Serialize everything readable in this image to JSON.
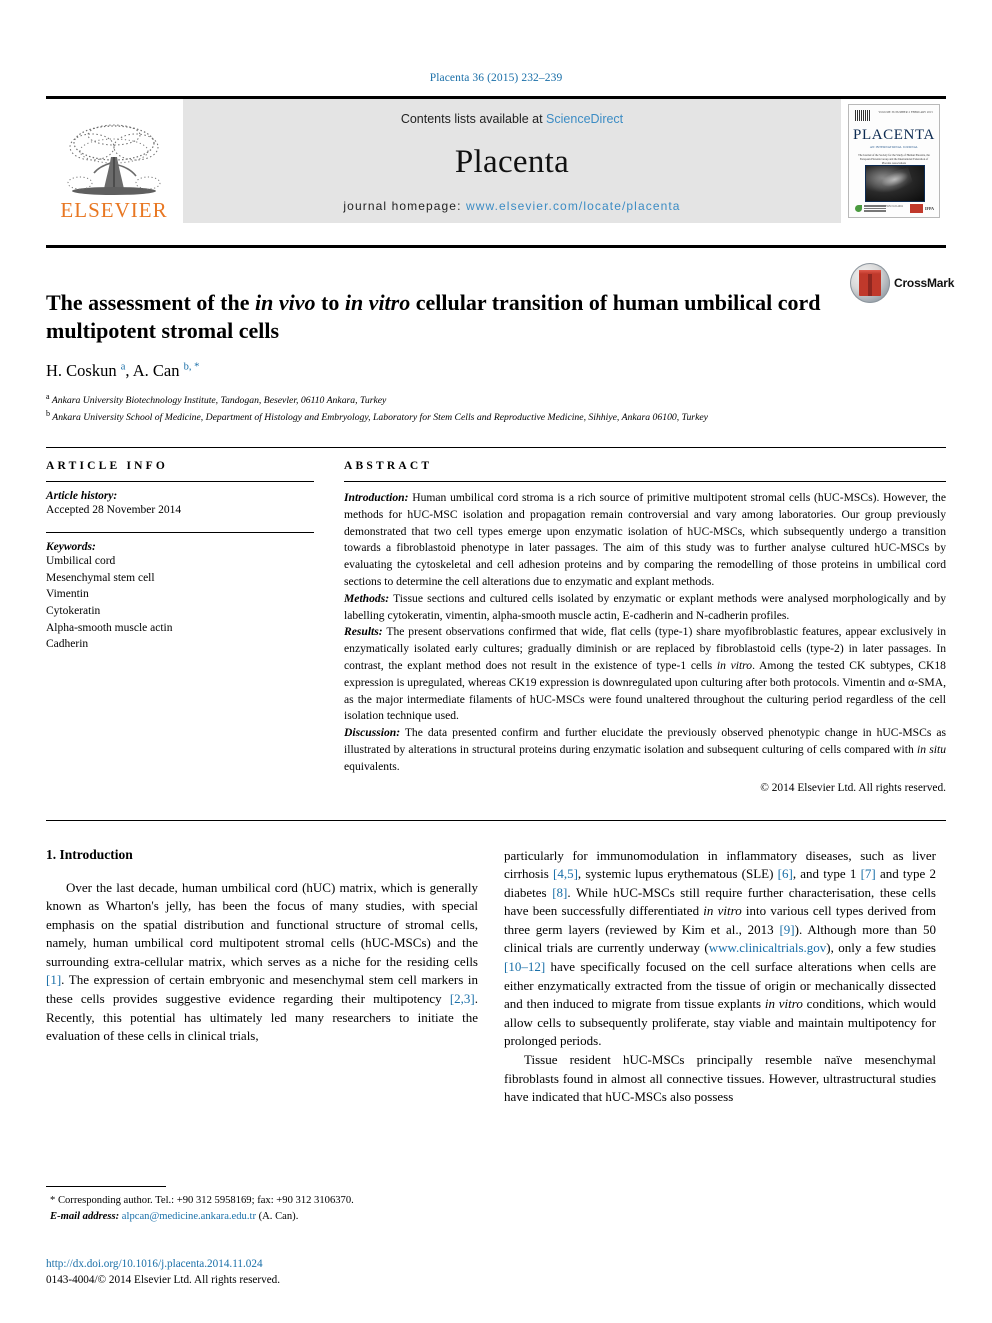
{
  "running_head": "Placenta 36 (2015) 232–239",
  "masthead": {
    "publisher": "ELSEVIER",
    "contents_prefix": "Contents lists available at ",
    "contents_link": "ScienceDirect",
    "journal_name": "Placenta",
    "homepage_prefix": "journal homepage: ",
    "homepage_url": "www.elsevier.com/locate/placenta",
    "cover": {
      "title": "PLACENTA",
      "subtitle": "AN INTERNATIONAL JOURNAL",
      "tagline": "The Journal of the Society for the Study of Human Placenta, the European Placenta Group and the International Federation of Placenta Associations",
      "topright": "VOLUME 36 NUMBER 2 FEBRUARY 2015",
      "caption": "ISSN 0143-4004",
      "badge": "IFPA"
    }
  },
  "article": {
    "title_part1": "The assessment of the ",
    "title_italic1": "in vivo",
    "title_part2": " to ",
    "title_italic2": "in vitro",
    "title_part3": " cellular transition of human umbilical cord multipotent stromal cells",
    "authors_plain": "H. Coskun ",
    "author1_sup": "a",
    "authors_mid": ", A. Can ",
    "author2_sup": "b, *",
    "affiliation_a_sup": "a",
    "affiliation_a": " Ankara University Biotechnology Institute, Tandogan, Besevler, 06110 Ankara, Turkey",
    "affiliation_b_sup": "b",
    "affiliation_b": " Ankara University School of Medicine, Department of Histology and Embryology, Laboratory for Stem Cells and Reproductive Medicine, Sihhiye, Ankara 06100, Turkey",
    "crossmark_label": "CrossMark"
  },
  "article_info": {
    "heading": "ARTICLE INFO",
    "history_label": "Article history:",
    "history_value": "Accepted 28 November 2014",
    "keywords_label": "Keywords:",
    "keywords": [
      "Umbilical cord",
      "Mesenchymal stem cell",
      "Vimentin",
      "Cytokeratin",
      "Alpha-smooth muscle actin",
      "Cadherin"
    ]
  },
  "abstract": {
    "heading": "ABSTRACT",
    "intro_label": "Introduction:",
    "intro_text": " Human umbilical cord stroma is a rich source of primitive multipotent stromal cells (hUC-MSCs). However, the methods for hUC-MSC isolation and propagation remain controversial and vary among laboratories. Our group previously demonstrated that two cell types emerge upon enzymatic isolation of hUC-MSCs, which subsequently undergo a transition towards a fibroblastoid phenotype in later passages. The aim of this study was to further analyse cultured hUC-MSCs by evaluating the cytoskeletal and cell adhesion proteins and by comparing the remodelling of those proteins in umbilical cord sections to determine the cell alterations due to enzymatic and explant methods.",
    "methods_label": "Methods:",
    "methods_text": " Tissue sections and cultured cells isolated by enzymatic or explant methods were analysed morphologically and by labelling cytokeratin, vimentin, alpha-smooth muscle actin, E-cadherin and N-cadherin profiles.",
    "results_label": "Results:",
    "results_text1": " The present observations confirmed that wide, flat cells (type-1) share myofibroblastic features, appear exclusively in enzymatically isolated early cultures; gradually diminish or are replaced by fibroblastoid cells (type-2) in later passages. In contrast, the explant method does not result in the existence of type-1 cells ",
    "results_italic": "in vitro",
    "results_text2": ". Among the tested CK subtypes, CK18 expression is upregulated, whereas CK19 expression is downregulated upon culturing after both protocols. Vimentin and α-SMA, as the major intermediate filaments of hUC-MSCs were found unaltered throughout the culturing period regardless of the cell isolation technique used.",
    "discussion_label": "Discussion:",
    "discussion_text1": " The data presented confirm and further elucidate the previously observed phenotypic change in hUC-MSCs as illustrated by alterations in structural proteins during enzymatic isolation and subsequent culturing of cells compared with ",
    "discussion_italic": "in situ",
    "discussion_text2": " equivalents.",
    "copyright": "© 2014 Elsevier Ltd. All rights reserved."
  },
  "body": {
    "section_title": "1. Introduction",
    "left_p1_a": "Over the last decade, human umbilical cord (hUC) matrix, which is generally known as Wharton's jelly, has been the focus of many studies, with special emphasis on the spatial distribution and functional structure of stromal cells, namely, human umbilical cord multipotent stromal cells (hUC-MSCs) and the surrounding extra-cellular matrix, which serves as a niche for the residing cells ",
    "left_cite1": "[1]",
    "left_p1_b": ". The expression of certain embryonic and mesenchymal stem cell markers in these cells provides suggestive evidence regarding their multipotency ",
    "left_cite2": "[2,3]",
    "left_p1_c": ". Recently, this potential has ultimately led many researchers to initiate the evaluation of these cells in clinical trials,",
    "right_p1_a": "particularly for immunomodulation in inflammatory diseases, such as liver cirrhosis ",
    "right_cite1": "[4,5]",
    "right_p1_b": ", systemic lupus erythematous (SLE) ",
    "right_cite2": "[6]",
    "right_p1_c": ", and type 1 ",
    "right_cite3": "[7]",
    "right_p1_d": " and type 2 diabetes ",
    "right_cite4": "[8]",
    "right_p1_e": ". While hUC-MSCs still require further characterisation, these cells have been successfully differentiated ",
    "right_italic1": "in vitro",
    "right_p1_f": " into various cell types derived from three germ layers (reviewed by Kim et al., 2013 ",
    "right_cite5": "[9]",
    "right_p1_g": "). Although more than 50 clinical trials are currently underway (",
    "right_url": "www.clinicaltrials.gov",
    "right_p1_h": "), only a few studies ",
    "right_cite6": "[10–12]",
    "right_p1_i": " have specifically focused on the cell surface alterations when cells are either enzymatically extracted from the tissue of origin or mechanically dissected and then induced to migrate from tissue explants ",
    "right_italic2": "in vitro",
    "right_p1_j": " conditions, which would allow cells to subsequently proliferate, stay viable and maintain multipotency for prolonged periods.",
    "right_p2_a": "Tissue resident hUC-MSCs principally resemble naïve mesenchymal fibroblasts found in almost all connective tissues. However, ultrastructural studies have indicated that hUC-MSCs also possess"
  },
  "footer": {
    "corr_star": "*",
    "corr_text": " Corresponding author. Tel.: +90 312 5958169; fax: +90 312 3106370.",
    "email_label": "E-mail address:",
    "email": " alpcan@medicine.ankara.edu.tr",
    "email_suffix": " (A. Can).",
    "doi": "http://dx.doi.org/10.1016/j.placenta.2014.11.024",
    "issn_line": "0143-4004/© 2014 Elsevier Ltd. All rights reserved."
  },
  "colors": {
    "link": "#1a6fa8",
    "elsevier_orange": "#E87722",
    "banner_bg": "#e4e4e4",
    "crossmark_red": "#c0392b"
  }
}
